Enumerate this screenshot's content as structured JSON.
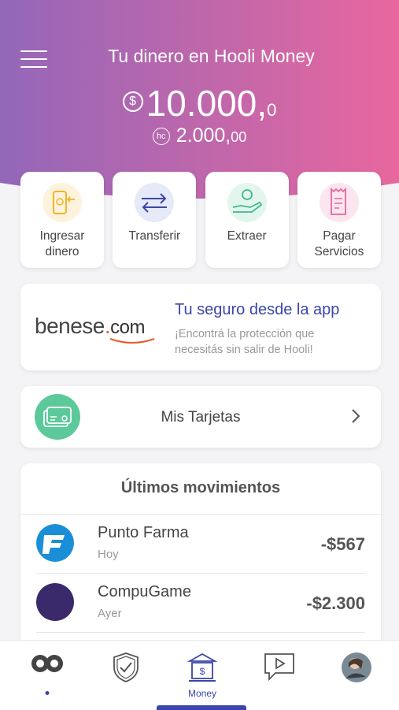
{
  "header": {
    "title": "Tu dinero en Hooli Money",
    "currency_symbol": "$",
    "balance_main": "10.000,",
    "balance_decimals": "0",
    "hc_symbol": "hc",
    "hc_main": "2.000,",
    "hc_decimals": "00",
    "gradient_left": "#9367b9",
    "gradient_right": "#e8679e"
  },
  "actions": [
    {
      "label_line1": "Ingresar",
      "label_line2": "dinero",
      "icon": "phone-deposit-icon"
    },
    {
      "label_line1": "Transferir",
      "label_line2": "",
      "icon": "transfer-arrows-icon"
    },
    {
      "label_line1": "Extraer",
      "label_line2": "",
      "icon": "hand-coin-icon"
    },
    {
      "label_line1": "Pagar",
      "label_line2": "Servicios",
      "icon": "receipt-icon"
    }
  ],
  "benese": {
    "logo_text": "benese",
    "logo_dot": ".",
    "logo_com": "com",
    "title": "Tu seguro desde la app",
    "subtitle": "¡Encontrá la protección que necesitás sin salir de Hooli!"
  },
  "tarjetas": {
    "label": "Mis Tarjetas"
  },
  "movimientos": {
    "title": "Últimos movimientos",
    "items": [
      {
        "name": "Punto Farma",
        "date": "Hoy",
        "amount": "-$567"
      },
      {
        "name": "CompuGame",
        "date": "Ayer",
        "amount": "-$2.300"
      }
    ]
  },
  "tabbar": {
    "money_label": "Money",
    "accent": "#3b46a8"
  }
}
